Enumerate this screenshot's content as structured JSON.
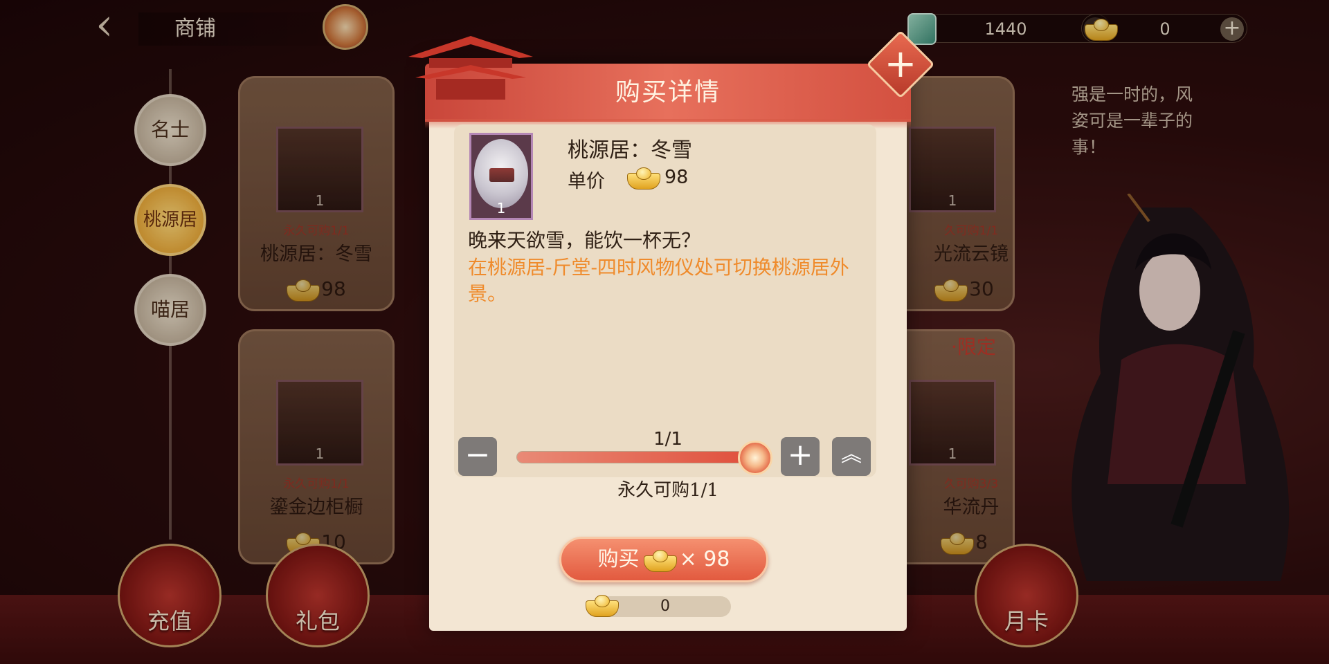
{
  "header": {
    "title": "商铺",
    "currencies": [
      {
        "name": "jade",
        "value": "1440"
      },
      {
        "name": "gold-ingot",
        "value": "0"
      }
    ]
  },
  "categories": [
    {
      "label": "名士",
      "active": false
    },
    {
      "label": "桃源居",
      "active": true
    },
    {
      "label": "喵居",
      "active": false
    }
  ],
  "shop_cards": [
    {
      "thumb_count": "1",
      "limit": "永久可购1/1",
      "name": "桃源居：冬雪",
      "price": "98"
    },
    {
      "thumb_count": "1",
      "limit": "久可购1/1",
      "name": "光流云镜",
      "price": "30"
    },
    {
      "thumb_count": "1",
      "limit": "永久可购1/1",
      "name": "鎏金边柜橱",
      "price": "10"
    },
    {
      "thumb_count": "1",
      "limit": "久可购3/3",
      "name": "华流丹",
      "price": "8"
    }
  ],
  "limited_tag": "·限定",
  "character_quote": "强是一时的，风姿可是一辈子的事！",
  "bottom_nav": [
    {
      "label": "充值"
    },
    {
      "label": "礼包"
    },
    {
      "label": "月卡"
    }
  ],
  "modal": {
    "title": "购买详情",
    "item": {
      "name": "桃源居：冬雪",
      "thumb_count": "1",
      "unit_label": "单价",
      "unit_price": "98",
      "flavor": "晚来天欲雪，能饮一杯无？",
      "effect": "在桃源居-斤堂-四时风物仪处可切换桃源居外景。"
    },
    "quantity": {
      "display": "1/1",
      "current": 1,
      "max": 1,
      "limit_text": "永久可购1/1"
    },
    "buy": {
      "label": "购买",
      "multiplier": "× 98"
    },
    "balance": "0"
  },
  "colors": {
    "accent": "#e25a3f",
    "effect_text": "#ef8b2c",
    "panel_bg": "#f3e6d3"
  }
}
